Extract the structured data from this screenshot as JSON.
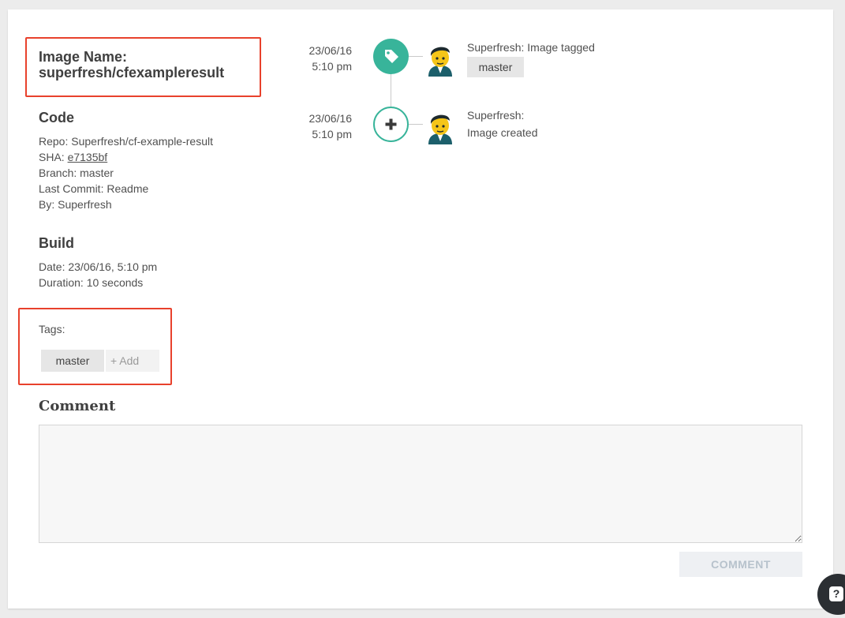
{
  "image": {
    "name_label": "Image Name:",
    "name_value": "superfresh/cfexampleresult"
  },
  "code": {
    "title": "Code",
    "repo": "Repo: Superfresh/cf-example-result",
    "sha_label": "SHA: ",
    "sha_value": "e7135bf",
    "branch": "Branch: master",
    "last_commit": "Last Commit: Readme",
    "by": "By: Superfresh"
  },
  "build": {
    "title": "Build",
    "date": "Date: 23/06/16, 5:10 pm",
    "duration": "Duration: 10 seconds"
  },
  "tags": {
    "label": "Tags:",
    "items": [
      "master"
    ],
    "add_label": "+ Add"
  },
  "comment": {
    "title": "Comment",
    "value": "",
    "button_label": "COMMENT"
  },
  "timeline": [
    {
      "date": "23/06/16",
      "time": "5:10 pm",
      "icon": "tag-icon",
      "text": "Superfresh: Image tagged",
      "tag": "master"
    },
    {
      "date": "23/06/16",
      "time": "5:10 pm",
      "icon": "plus-icon",
      "text_line1": "Superfresh:",
      "text_line2": "Image created"
    }
  ],
  "help": {
    "glyph": "?"
  },
  "colors": {
    "accent": "#38b49a",
    "highlight": "#e8412c",
    "button_text_disabled": "#b7c2cc"
  }
}
